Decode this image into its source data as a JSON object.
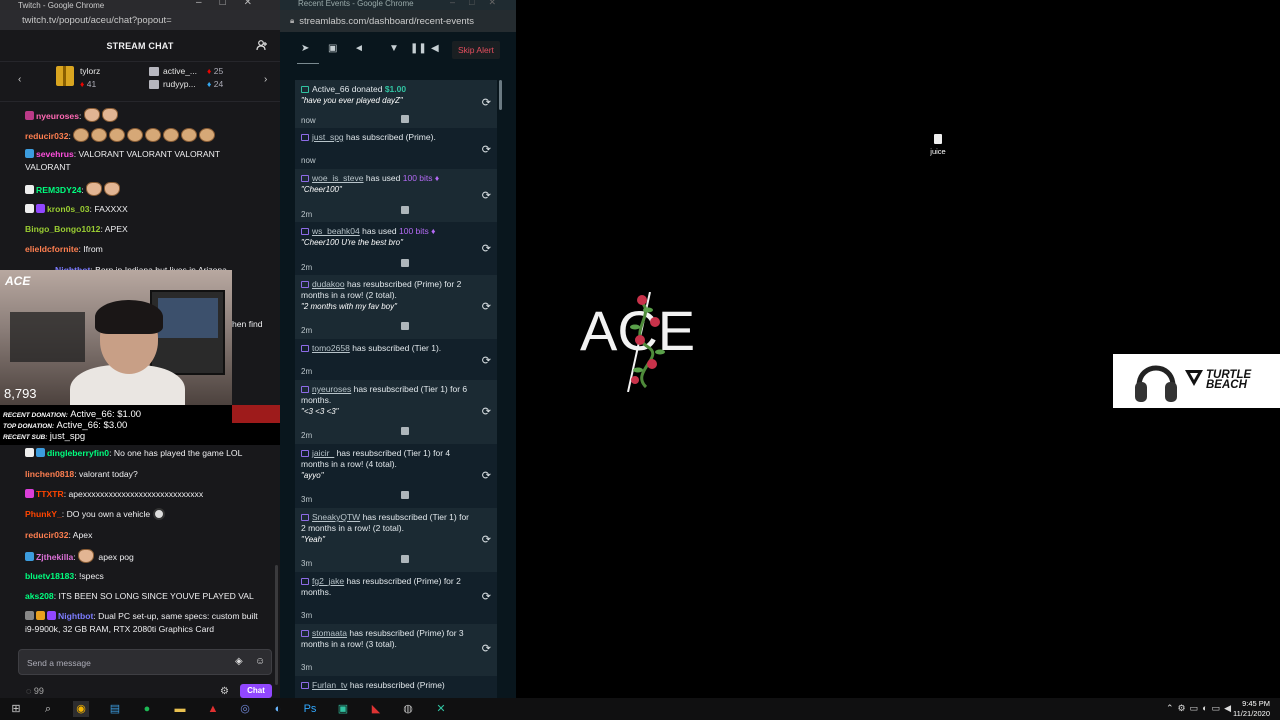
{
  "twitch": {
    "window_title": "Twitch - Google Chrome",
    "url": "twitch.tv/popout/aceu/chat?popout=",
    "header": "STREAM CHAT",
    "leaderboard": [
      {
        "name": "tylorz",
        "count": "41"
      },
      {
        "name": "active_...",
        "count": "25"
      },
      {
        "name": "rudyyp...",
        "count": "24"
      }
    ],
    "messages": [
      {
        "user": "nyeuroses",
        "color": "#ff69b4",
        "text": ""
      },
      {
        "user": "reducir032",
        "color": "#ff7f50",
        "text": ""
      },
      {
        "user": "sevehrus",
        "color": "#ff4fde",
        "text": "VALORANT VALORANT VALORANT VALORANT"
      },
      {
        "user": "REM3DY24",
        "color": "#00ff7f",
        "text": ""
      },
      {
        "user": "kron0s_03",
        "color": "#9acd32",
        "text": "FAXXXX"
      },
      {
        "user": "Bingo_Bongo1012",
        "color": "#9acd32",
        "text": "APEX"
      },
      {
        "user": "elieldcfornite",
        "color": "#ff7f50",
        "text": "Ifrom"
      },
      {
        "user": "Nightbot",
        "color": "#7c7cff",
        "text": "Born in Indiana but lives in Arizona"
      },
      {
        "user": "",
        "color": "#efeff1",
        "text": "hen find"
      },
      {
        "user": "dingleberryfin0",
        "color": "#00ff7f",
        "text": "No one has played the game LOL"
      },
      {
        "user": "linchen0818",
        "color": "#ff7f50",
        "text": "valorant today?"
      },
      {
        "user": "TTXTR",
        "color": "#ff4500",
        "text": "apexxxxxxxxxxxxxxxxxxxxxxxxxxxx"
      },
      {
        "user": "PhunkY_",
        "color": "#ff4500",
        "text": "DO you own a vehicle"
      },
      {
        "user": "reducir032",
        "color": "#ff7f50",
        "text": "Apex"
      },
      {
        "user": "Zjthekilla",
        "color": "#da70d6",
        "text": "apex pog"
      },
      {
        "user": "bluetv18183",
        "color": "#00ff7f",
        "text": "!specs"
      },
      {
        "user": "aks208",
        "color": "#00ff7f",
        "text": "ITS BEEN SO LONG SINCE YOUVE PLAYED VAL"
      },
      {
        "user": "Nightbot",
        "color": "#7c7cff",
        "text": "Dual PC set-up, same specs: custom built i9-9900k, 32 GB RAM, RTX 2080ti Graphics Card"
      }
    ],
    "input_placeholder": "Send a message",
    "chat_button": "Chat",
    "points": "99"
  },
  "webcam": {
    "tag": "ACE",
    "viewers": "8,793",
    "recent_donation_label": "RECENT DONATION:",
    "recent_donation_value": "Active_66: $1.00",
    "top_donation_label": "TOP DONATION:",
    "top_donation_value": "Active_66: $3.00",
    "recent_sub_label": "RECENT SUB:",
    "recent_sub_value": "just_spg"
  },
  "streamlabs": {
    "window_title": "Recent Events - Google Chrome",
    "url": "streamlabs.com/dashboard/recent-events",
    "skip_alert": "Skip Alert",
    "events": [
      {
        "user": "Active_66",
        "action": "donated",
        "amount": "$1.00",
        "quote": "\"have you ever played dayZ\"",
        "time": "now"
      },
      {
        "user": "just_spg",
        "action": "has subscribed (Prime).",
        "time": "now"
      },
      {
        "user": "woe_is_steve",
        "action": "has used",
        "bits": "100 bits",
        "quote": "\"Cheer100\"",
        "time": "2m"
      },
      {
        "user": "ws_beahk04",
        "action": "has used",
        "bits": "100 bits",
        "quote": "\"Cheer100 U're the best bro\"",
        "time": "2m"
      },
      {
        "user": "dudakoo",
        "action": "has resubscribed (Prime) for 2 months in a row! (2 total).",
        "quote": "\"2 months with my fav boy\"",
        "time": "2m"
      },
      {
        "user": "tomo2658",
        "action": "has subscribed (Tier 1).",
        "time": "2m"
      },
      {
        "user": "nyeuroses",
        "action": "has resubscribed (Tier 1) for 6 months.",
        "quote": "\"<3 <3 <3\"",
        "time": "2m"
      },
      {
        "user": "jaicir_",
        "action": "has resubscribed (Tier 1) for 4 months in a row! (4 total).",
        "quote": "\"ayyo\"",
        "time": "3m"
      },
      {
        "user": "SneakyQTW",
        "action": "has resubscribed (Tier 1) for 2 months in a row! (2 total).",
        "quote": "\"Yeah\"",
        "time": "3m"
      },
      {
        "user": "fg2_jake",
        "action": "has resubscribed (Prime) for 2 months.",
        "time": "3m"
      },
      {
        "user": "stomaata",
        "action": "has resubscribed (Prime) for 3 months in a row! (3 total).",
        "time": "3m"
      },
      {
        "user": "Furlan_tv",
        "action": "has resubscribed (Prime)",
        "time": ""
      }
    ]
  },
  "desktop": {
    "file_icon_label": "juice",
    "logo_text": "ACE",
    "sponsor_text_1": "TURTLE",
    "sponsor_text_2": "BEACH"
  },
  "taskbar": {
    "time": "9:45 PM",
    "date": "11/21/2020"
  }
}
